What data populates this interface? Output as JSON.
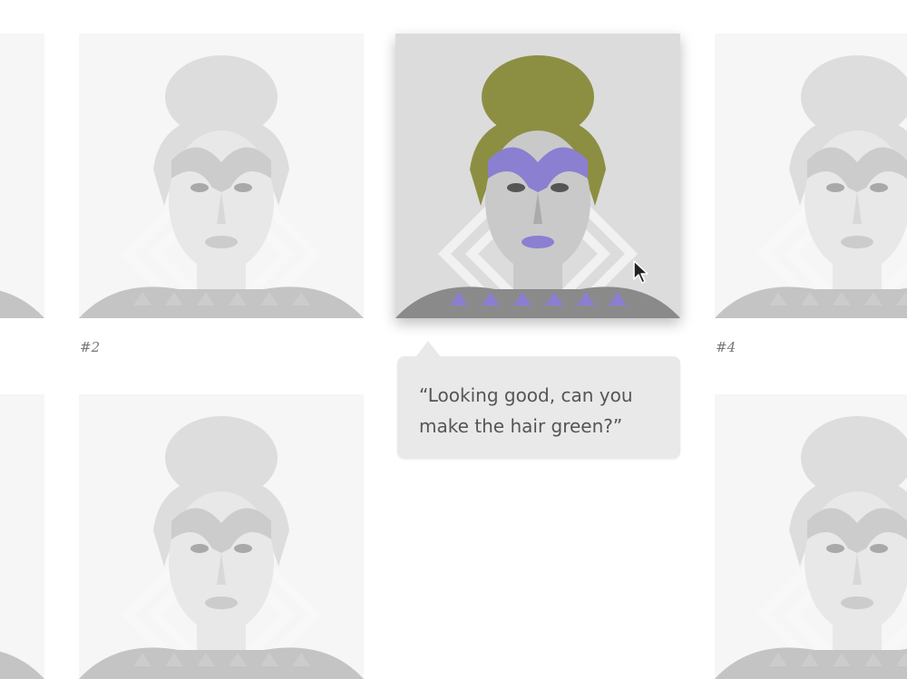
{
  "tiles": [
    {
      "id": "tile-1",
      "label": ""
    },
    {
      "id": "tile-2",
      "label": "#2"
    },
    {
      "id": "tile-3",
      "label": ""
    },
    {
      "id": "tile-4",
      "label": "#4"
    }
  ],
  "labels": {
    "tile2": "#2",
    "tile4": "#4"
  },
  "comment": {
    "text": "“Looking good, can you make the hair green?”"
  },
  "colors": {
    "hair": "#8c8f42",
    "facepaint": "#8a7fd1",
    "background": "#dcdcdc",
    "bubble": "#e9e9e9"
  },
  "icons": {
    "cursor": "arrow-cursor-icon"
  }
}
